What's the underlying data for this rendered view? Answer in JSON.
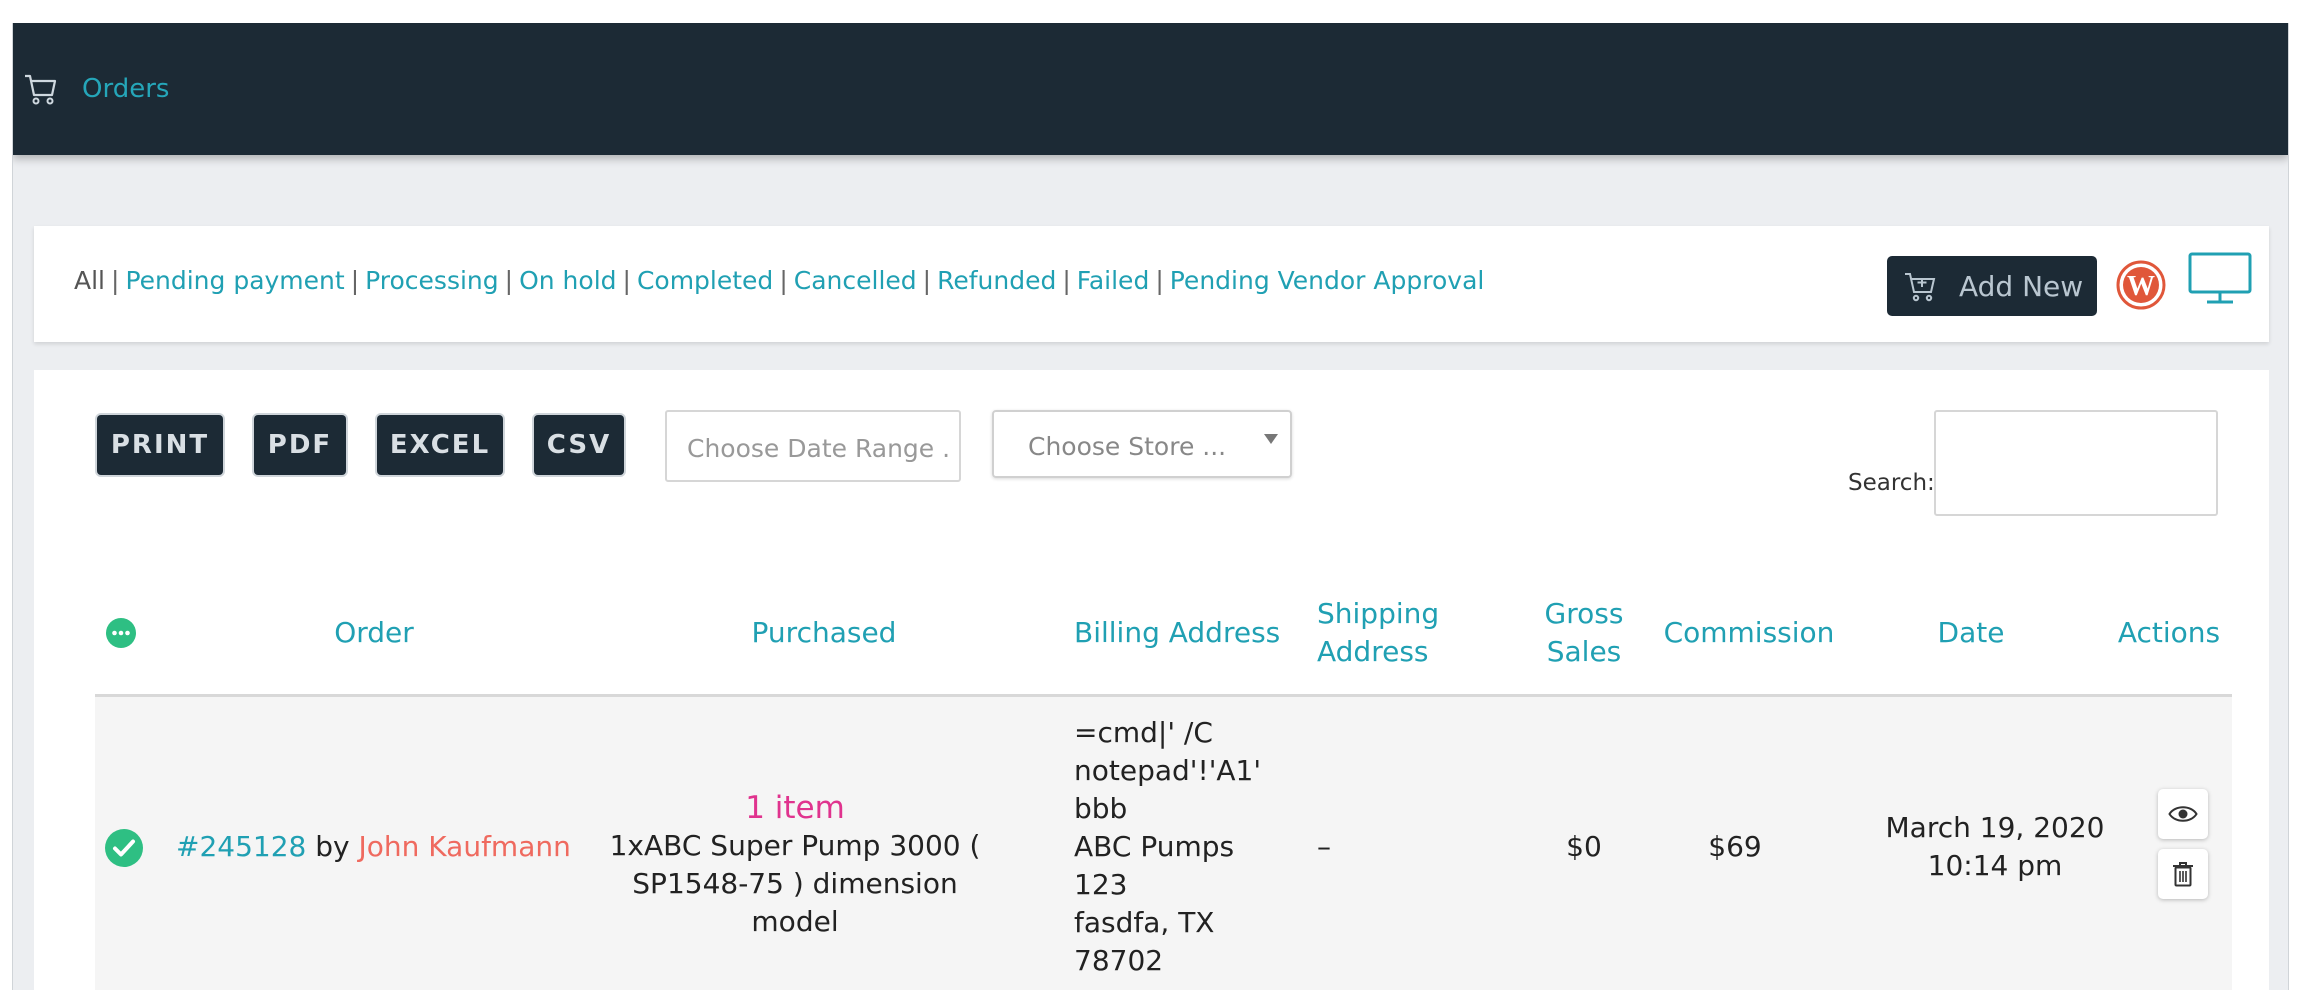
{
  "header": {
    "title": "Orders",
    "icon": "cart-icon"
  },
  "status_filters": {
    "all": "All",
    "items": [
      "Pending payment",
      "Processing",
      "On hold",
      "Completed",
      "Cancelled",
      "Refunded",
      "Failed",
      "Pending Vendor Approval"
    ]
  },
  "toolbar": {
    "add_new_label": "Add New",
    "export_buttons": [
      "PRINT",
      "PDF",
      "EXCEL",
      "CSV"
    ],
    "date_range_placeholder": "Choose Date Range .",
    "store_placeholder": "Choose Store ...",
    "search_label": "Search:"
  },
  "table": {
    "columns": {
      "order": "Order",
      "purchased": "Purchased",
      "billing": "Billing Address",
      "shipping_1": "Shipping",
      "shipping_2": "Address",
      "gross_1": "Gross",
      "gross_2": "Sales",
      "commission": "Commission",
      "date": "Date",
      "actions": "Actions"
    },
    "rows": [
      {
        "status": "completed",
        "order_number": "#245128",
        "by": "by",
        "customer": "John Kaufmann",
        "item_count": "1 item",
        "item_line_1": "1xABC Super Pump 3000 (",
        "item_line_2": "SP1548-75 ) dimension model",
        "billing_lines": [
          "=cmd|' /C",
          "notepad'!'A1'",
          "bbb",
          "ABC Pumps",
          "123",
          "fasdfa, TX",
          "78702"
        ],
        "shipping": "–",
        "gross_sales": "$0",
        "commission": "$69",
        "date": "March 19, 2020",
        "time": "10:14 pm"
      }
    ]
  },
  "colors": {
    "topbar": "#1c2a35",
    "accent": "#20a0b3",
    "customer": "#ef6a5f",
    "item_count": "#e0338e",
    "status_green": "#2ebf83"
  }
}
